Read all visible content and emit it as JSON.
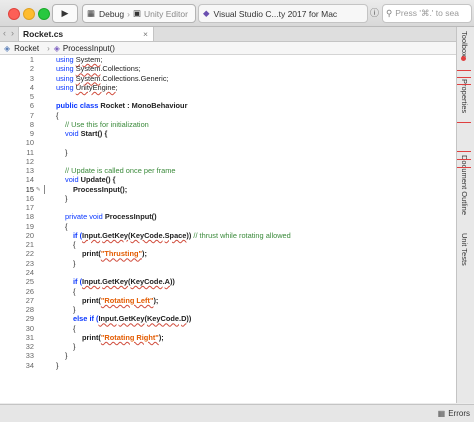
{
  "toolbar": {
    "scheme_config": "Debug",
    "scheme_target": "Unity Editor",
    "status_text": "Visual Studio C...ty 2017 for Mac",
    "search_placeholder": "Press '⌘.' to sea"
  },
  "tab": {
    "filename": "Rocket.cs",
    "close": "×"
  },
  "pathbar": {
    "class_name": "Rocket",
    "method_name": "ProcessInput()"
  },
  "sidebar": {
    "toolbox": "Toolbox",
    "properties": "Properties",
    "document_outline": "Document Outline",
    "unit_tests": "Unit Tests"
  },
  "errors": {
    "label": "Errors"
  },
  "code": {
    "l1": [
      "using ",
      "System",
      ";"
    ],
    "l2": [
      "using ",
      "System",
      ".Collections;"
    ],
    "l3": [
      "using ",
      "System",
      ".Collections.Generic;"
    ],
    "l4": [
      "using ",
      "UnityEngine",
      ";"
    ],
    "l6": [
      "public class ",
      "Rocket",
      " : ",
      "MonoBehaviour"
    ],
    "l7": "{",
    "l8": "// Use this for initialization",
    "l9": [
      "void ",
      "Start() {"
    ],
    "l11": "}",
    "l13": "// Update is called once per frame",
    "l14": [
      "void ",
      "Update() {"
    ],
    "l15": "ProcessInput();",
    "l16": "}",
    "l18": [
      "private void ",
      "ProcessInput()"
    ],
    "l19": "{",
    "l20": [
      "if (",
      "Input",
      ".",
      "GetKey",
      "(",
      "KeyCode",
      ".",
      "Space",
      ")) ",
      "// thrust while rotating allowed"
    ],
    "l21": "{",
    "l22": [
      "print(",
      "\"Thrusting\"",
      ");"
    ],
    "l23": "}",
    "l25": [
      "if (",
      "Input",
      ".",
      "GetKey",
      "(",
      "KeyCode",
      ".",
      "A",
      "))"
    ],
    "l26": "{",
    "l27": [
      "print(",
      "\"Rotating Left\"",
      ");"
    ],
    "l28": "}",
    "l29": [
      "else if (",
      "Input",
      ".",
      "GetKey",
      "(",
      "KeyCode",
      ".",
      "D",
      "))"
    ],
    "l30": "{",
    "l31": [
      "print(",
      "\"Rotating Right\"",
      ");"
    ],
    "l32": "}",
    "l33": "}",
    "l34": "}"
  }
}
